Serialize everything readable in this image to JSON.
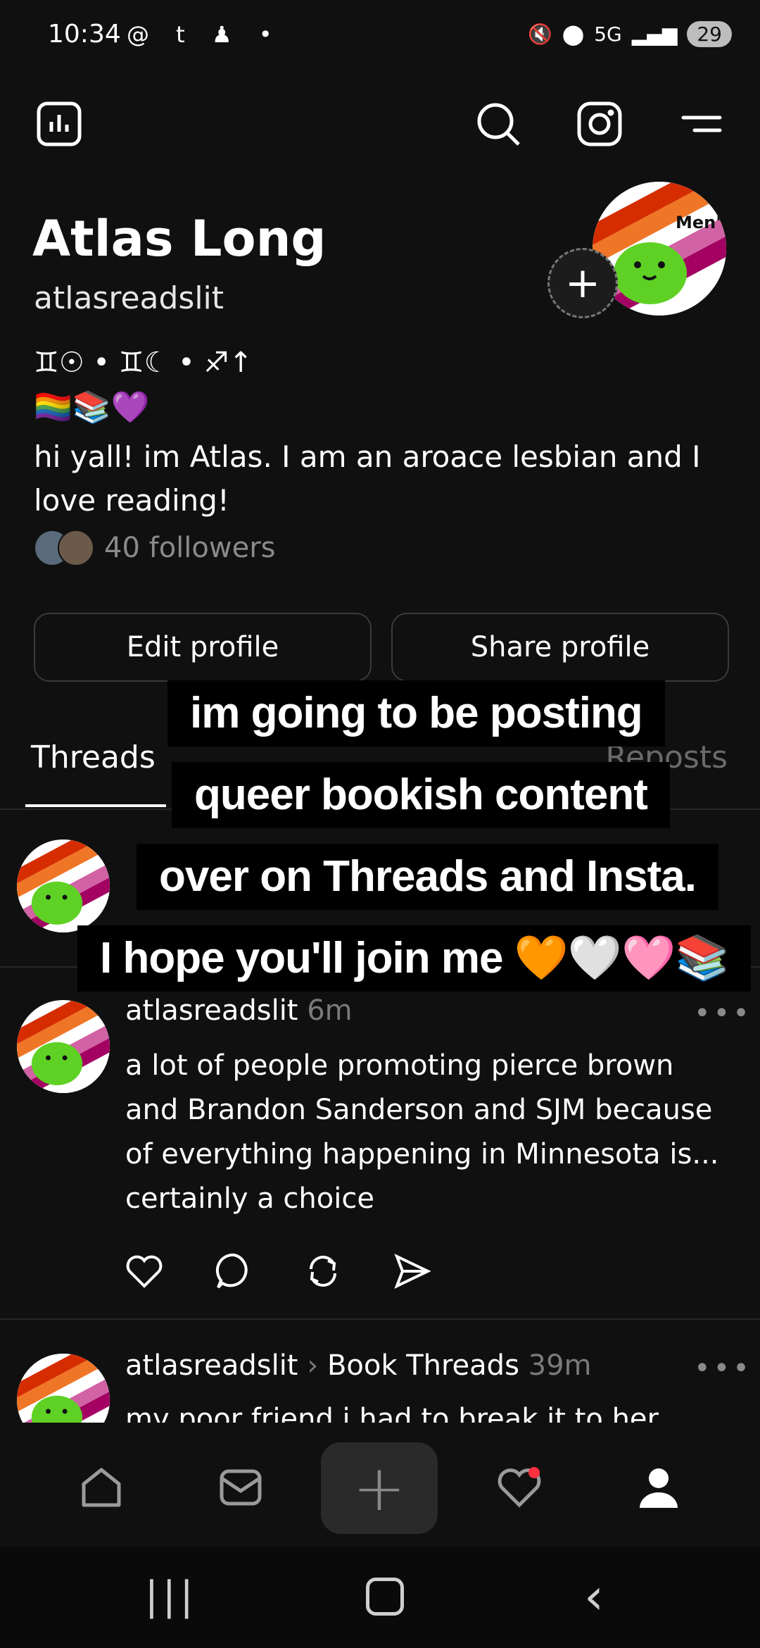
{
  "status_bar": {
    "time": "10:34",
    "app_icons": "@ t ♟ •",
    "signal": "5G",
    "battery": "29"
  },
  "toolbar": {
    "insights_icon": "bar-chart-icon",
    "search_icon": "search-icon",
    "instagram_icon": "instagram-icon",
    "menu_icon": "menu-icon"
  },
  "profile": {
    "name": "Atlas Long",
    "username": "atlasreadslit",
    "zodiac": "♊☉ • ♊☾ • ♐↑",
    "flag_emojis": "🏳️‍🌈📚💜",
    "bio": "hi yall! im Atlas. I am an aroace lesbian and I love reading!",
    "followers": "40 followers",
    "avatar_text": "Men't"
  },
  "buttons": {
    "edit": "Edit profile",
    "share": "Share profile"
  },
  "tabs": {
    "threads": "Threads",
    "reposts": "Reposts"
  },
  "overlay_caption": [
    "im going to be posting",
    "queer bookish content",
    "over on Threads and Insta.",
    "I hope you'll join me 🧡🤍🩷📚"
  ],
  "posts": [
    {
      "username": "atlasreadslit",
      "time": "6m",
      "text": "a lot of people promoting pierce brown and Brandon Sanderson and SJM because of everything happening in Minnesota is... certainly a choice"
    },
    {
      "username": "atlasreadslit",
      "community": "Book Threads",
      "time": "39m",
      "text": "my poor friend i had to break it to her"
    }
  ],
  "colors": {
    "background": "#101010",
    "notification_dot": "#ff3040",
    "muted_text": "#7a7a7a"
  },
  "bottom_nav": {
    "home": "home-icon",
    "messages": "inbox-icon",
    "create": "+",
    "activity": "heart-icon",
    "profile": "profile-icon"
  }
}
